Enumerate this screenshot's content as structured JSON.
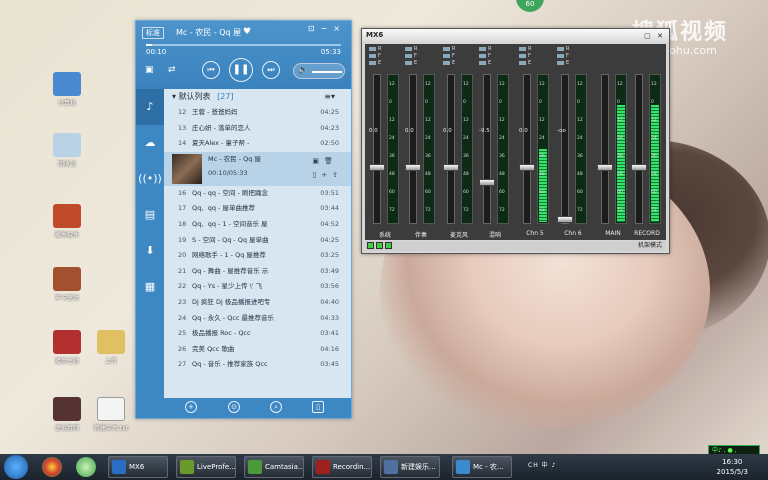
{
  "wallpaper": {
    "watermark": "搜狐视频",
    "watermark_url": "tv.sohu.com",
    "badge": "60"
  },
  "desktop_icons": [
    {
      "label": "计算机",
      "color": "#4a8ad0"
    },
    {
      "label": "回收站",
      "color": "#b9d2e6"
    },
    {
      "label": "聚秀软件",
      "color": "#c04a2a"
    },
    {
      "label": "声卡驱动",
      "color": "#a35030"
    },
    {
      "label": "播音主题",
      "color": "#b33030"
    },
    {
      "label": "上传",
      "color": "#e0c060"
    },
    {
      "label": "虚拟音频",
      "color": "#553333"
    },
    {
      "label": "新建文本.txt",
      "color": "#f4f4f4"
    }
  ],
  "player": {
    "tag": "标准",
    "title": "Mc - 农民 - Qq 屋",
    "elapsed": "00:10",
    "total": "05:33",
    "progress": 0.03,
    "list_name": "默认列表",
    "list_count": "[27]",
    "now_playing": {
      "title": "Mc - 农民 - Qq 屋",
      "time": "00:10/05:33"
    },
    "rows_before": [
      {
        "n": "12",
        "t": "王蓉 - 爸爸妈妈",
        "d": "04:25"
      },
      {
        "n": "13",
        "t": "庄心妍 - 落单的恋人",
        "d": "04:23"
      },
      {
        "n": "14",
        "t": "夏天Alex - 童子帮 -",
        "d": "02:50"
      }
    ],
    "rows_after": [
      {
        "n": "16",
        "t": "Qq - qq - 空间 - 刷把踊念",
        "d": "03:51"
      },
      {
        "n": "17",
        "t": "Qq、qq - 屋单曲推荐",
        "d": "03:44"
      },
      {
        "n": "18",
        "t": "Qq、qq - 1 - 空间音乐 屋",
        "d": "04:52"
      },
      {
        "n": "19",
        "t": "S - 空间 - Qq - Qq 屋单曲",
        "d": "04:25"
      },
      {
        "n": "20",
        "t": "网络歌手 - 1 - Qq 屋推荐",
        "d": "03:25"
      },
      {
        "n": "21",
        "t": "Qq - 舞曲 - 屋推荐音乐 示",
        "d": "03:49"
      },
      {
        "n": "22",
        "t": "Qq - Ys - 星少上传 \\' 飞",
        "d": "03:56"
      },
      {
        "n": "23",
        "t": "Dj 疯狂 Dj 极品播报进吧专",
        "d": "04:40"
      },
      {
        "n": "24",
        "t": "Qq - 永久 - Qcc 最推荐音乐",
        "d": "04:33"
      },
      {
        "n": "25",
        "t": "极品播报 Roc - Qcc",
        "d": "03:41"
      },
      {
        "n": "26",
        "t": "完美 Qcc 歌曲",
        "d": "04:16"
      },
      {
        "n": "27",
        "t": "Qq - 音乐 - 推荐家族 Qcc",
        "d": "03:45"
      }
    ]
  },
  "mixer": {
    "title": "MX6",
    "channels": [
      {
        "name": "系统",
        "value": "0.0",
        "level": 0.0
      },
      {
        "name": "伴奏",
        "value": "0.0",
        "level": 0.0
      },
      {
        "name": "麦克风",
        "value": "0.0",
        "level": 0.0
      },
      {
        "name": "混响",
        "value": "-9.5",
        "level": 0.0
      },
      {
        "name": "Chn 5",
        "value": "0.0",
        "level": 0.5
      },
      {
        "name": "Chn 6",
        "value": "-oo",
        "level": 0.0
      },
      {
        "name": "MAIN",
        "value": "",
        "level": 0.8
      },
      {
        "name": "RECORD",
        "value": "",
        "level": 0.8
      }
    ],
    "status_right": "机架模式"
  },
  "taskbar": {
    "items": [
      {
        "label": "MX6",
        "color": "#2b6cc4"
      },
      {
        "label": "LiveProfe...",
        "color": "#6a9b2a"
      },
      {
        "label": "Camtasia...",
        "color": "#4a9a3a"
      },
      {
        "label": "Recordin...",
        "color": "#a02020"
      },
      {
        "label": "新建娱乐...",
        "color": "#5070a0"
      },
      {
        "label": "Mc - 农...",
        "color": "#3a8ad0"
      }
    ],
    "tray": "CH 中 ♪",
    "time": "16:30",
    "date": "2015/5/3",
    "ime": "中♪ , ● ,"
  }
}
